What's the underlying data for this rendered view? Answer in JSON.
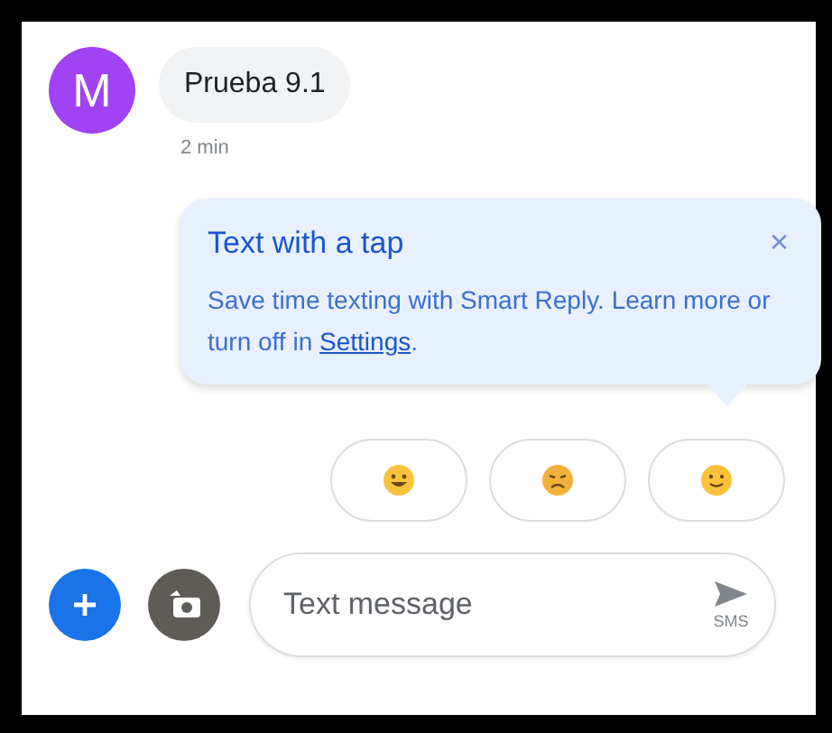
{
  "conversation": {
    "avatar": {
      "initial": "M",
      "color": "#a142f4"
    },
    "message": {
      "text": "Prueba 9.1",
      "time": "2 min"
    }
  },
  "tip": {
    "title": "Text with a tap",
    "close": "×",
    "body": "Save time texting with Smart Reply. Learn more or turn off in ",
    "link": "Settings",
    "end": "."
  },
  "smart_replies": [
    {
      "kind": "grin"
    },
    {
      "kind": "wince"
    },
    {
      "kind": "smile"
    }
  ],
  "compose": {
    "placeholder": "Text message",
    "send_label": "SMS"
  }
}
